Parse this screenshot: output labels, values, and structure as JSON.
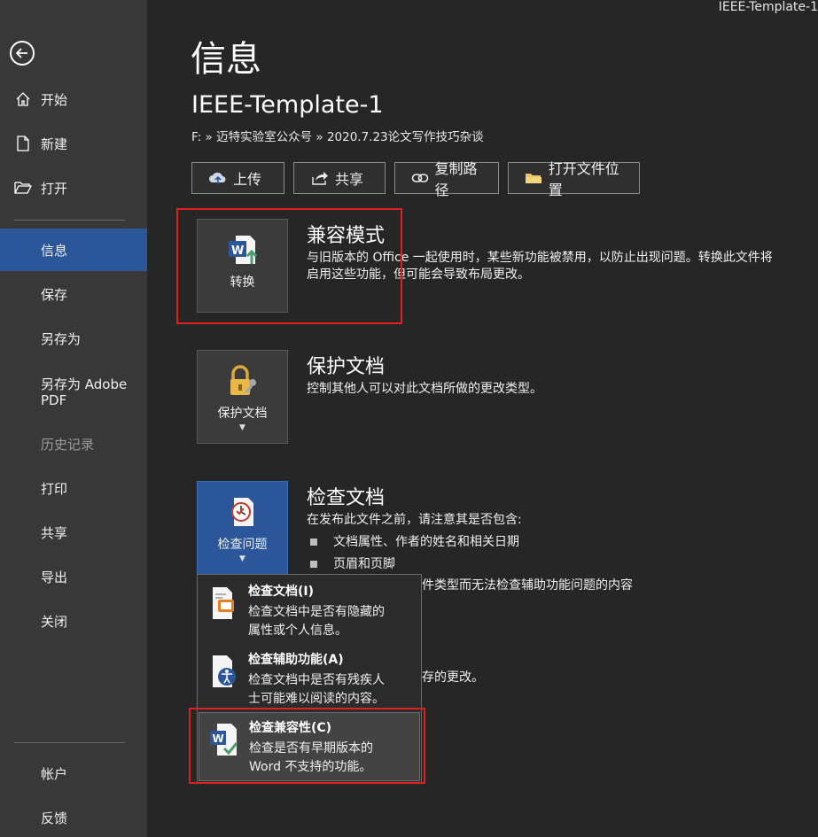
{
  "window_title": "IEEE-Template-1",
  "sidebar": {
    "items": [
      {
        "label": "开始"
      },
      {
        "label": "新建"
      },
      {
        "label": "打开"
      },
      {
        "label": "信息"
      },
      {
        "label": "保存"
      },
      {
        "label": "另存为"
      },
      {
        "label": "另存为 Adobe PDF"
      },
      {
        "label": "历史记录"
      },
      {
        "label": "打印"
      },
      {
        "label": "共享"
      },
      {
        "label": "导出"
      },
      {
        "label": "关闭"
      },
      {
        "label": "帐户"
      },
      {
        "label": "反馈"
      }
    ]
  },
  "main": {
    "title": "信息",
    "doc_name": "IEEE-Template-1",
    "path": "F: » 迈特实验室公众号 » 2020.7.23论文写作技巧杂谈",
    "actions": [
      {
        "label": "上传"
      },
      {
        "label": "共享"
      },
      {
        "label": "复制路径"
      },
      {
        "label": "打开文件位置"
      }
    ],
    "compat": {
      "tile_label": "转换",
      "heading": "兼容模式",
      "desc_line1": "与旧版本的 Office 一起使用时，某些新功能被禁用，以防止出现问题。转换此文件将",
      "desc_line2": "启用这些功能，但可能会导致布局更改。"
    },
    "protect": {
      "tile_label": "保护文档",
      "heading": "保护文档",
      "desc": "控制其他人可以对此文档所做的更改类型。"
    },
    "inspect": {
      "tile_label": "检查问题",
      "heading": "检查文档",
      "desc": "在发布此文件之前，请注意其是否包含:",
      "bullets": [
        "文档属性、作者的姓名和相关日期",
        "页眉和页脚"
      ],
      "partial_line": "件类型而无法检查辅助功能问题的内容",
      "partial_line2": "存的更改。"
    },
    "dropdown": [
      {
        "title": "检查文档(I)",
        "desc_line1": "检查文档中是否有隐藏的",
        "desc_line2": "属性或个人信息。"
      },
      {
        "title": "检查辅助功能(A)",
        "desc_line1": "检查文档中是否有残疾人",
        "desc_line2": "士可能难以阅读的内容。"
      },
      {
        "title": "检查兼容性(C)",
        "desc_line1": "检查是否有早期版本的",
        "desc_line2": "Word 不支持的功能。"
      }
    ]
  },
  "colors": {
    "sidebar_bg": "#383838",
    "main_bg": "#262626",
    "active_blue": "#2b579a",
    "highlight_red": "#e02020"
  }
}
